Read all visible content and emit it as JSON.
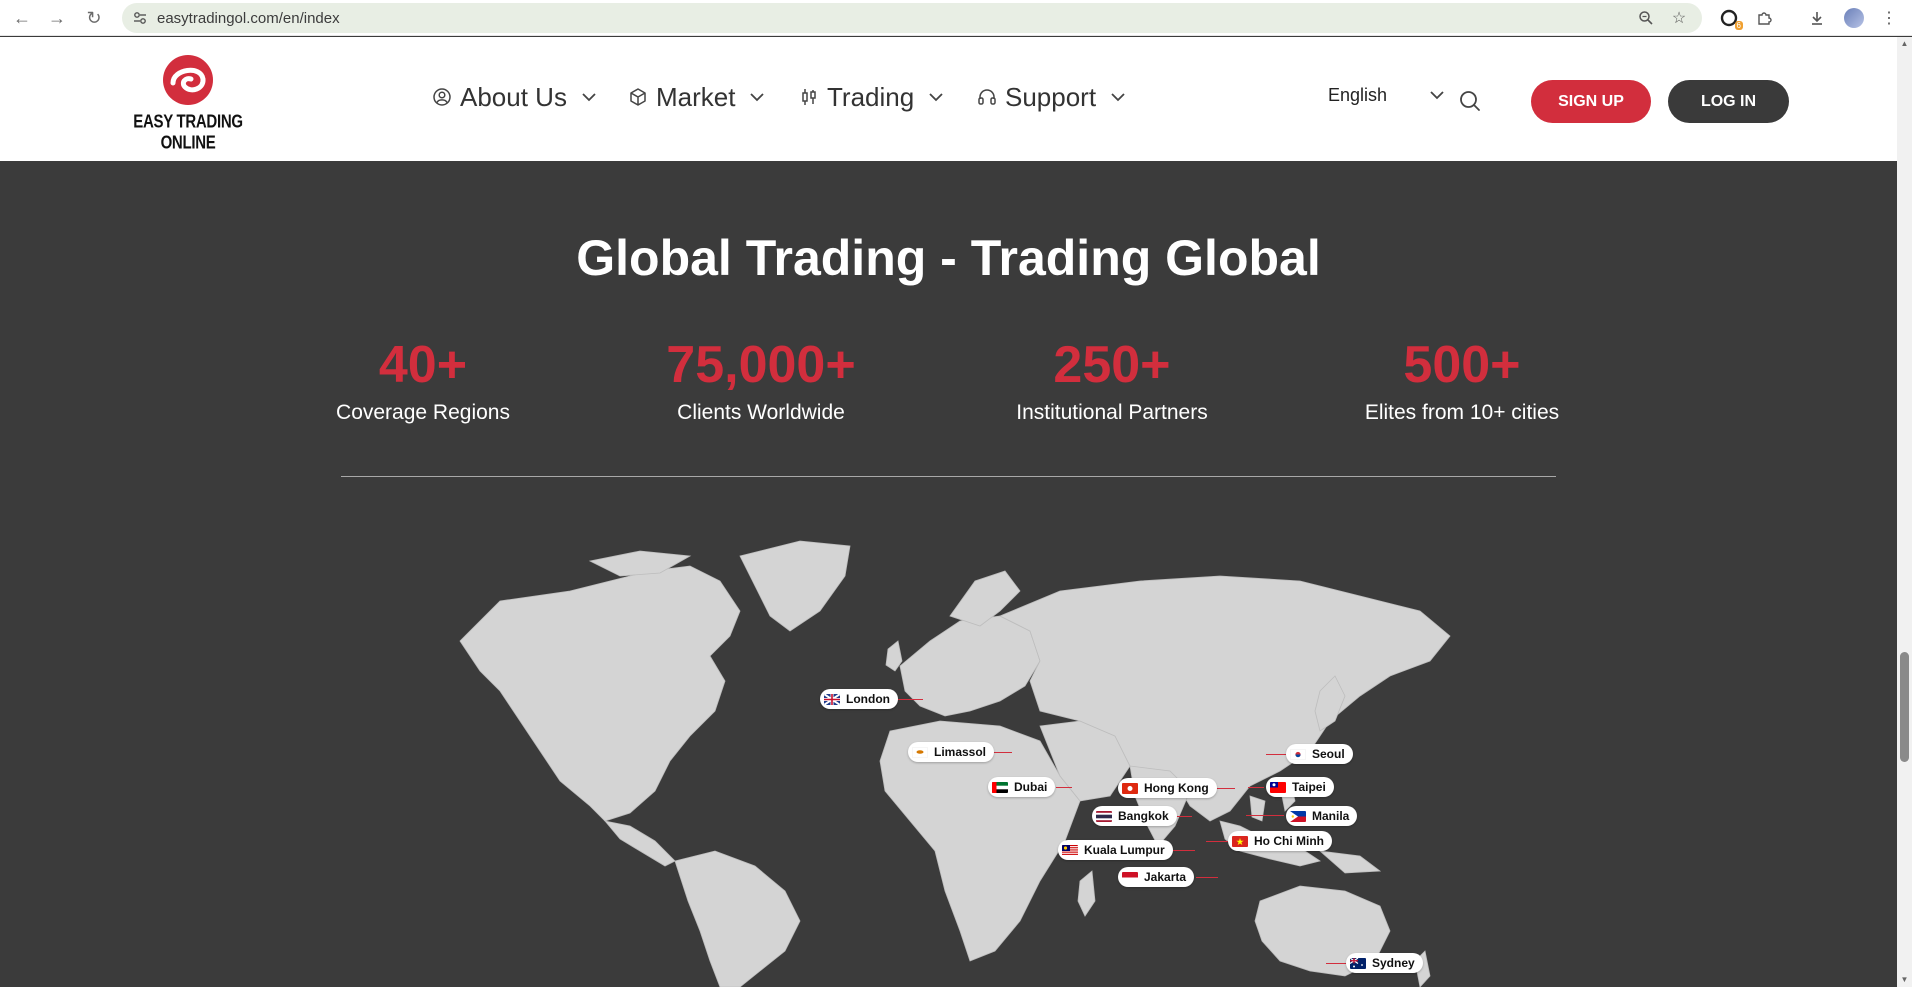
{
  "browser": {
    "url": "easytradingol.com/en/index",
    "extension_badge": "6"
  },
  "header": {
    "logo_text": "EASY TRADING ONLINE",
    "menu": [
      {
        "label": "About Us",
        "icon": "user-circle-icon"
      },
      {
        "label": "Market",
        "icon": "cube-icon"
      },
      {
        "label": "Trading",
        "icon": "candlestick-icon"
      },
      {
        "label": "Support",
        "icon": "headset-icon"
      }
    ],
    "language": "English",
    "signup_label": "SIGN UP",
    "login_label": "LOG IN"
  },
  "hero": {
    "title": "Global Trading - Trading Global",
    "stats": [
      {
        "value": "40+",
        "label": "Coverage Regions"
      },
      {
        "value": "75,000+",
        "label": "Clients Worldwide"
      },
      {
        "value": "250+",
        "label": "Institutional Partners"
      },
      {
        "value": "500+",
        "label": "Elites from 10+ cities"
      }
    ]
  },
  "map": {
    "cities": [
      {
        "name": "London",
        "flag": "uk"
      },
      {
        "name": "Limassol",
        "flag": "cy"
      },
      {
        "name": "Dubai",
        "flag": "ae"
      },
      {
        "name": "Hong Kong",
        "flag": "hk"
      },
      {
        "name": "Bangkok",
        "flag": "th"
      },
      {
        "name": "Kuala Lumpur",
        "flag": "my"
      },
      {
        "name": "Jakarta",
        "flag": "id"
      },
      {
        "name": "Seoul",
        "flag": "kr"
      },
      {
        "name": "Taipei",
        "flag": "tw"
      },
      {
        "name": "Manila",
        "flag": "ph"
      },
      {
        "name": "Ho Chi Minh",
        "flag": "vn"
      },
      {
        "name": "Sydney",
        "flag": "au"
      }
    ]
  },
  "colors": {
    "accent_red": "#d22e3d",
    "section_bg": "#3b3b3b",
    "map_land": "#d4d4d4",
    "login_bg": "#3a3a3a"
  }
}
